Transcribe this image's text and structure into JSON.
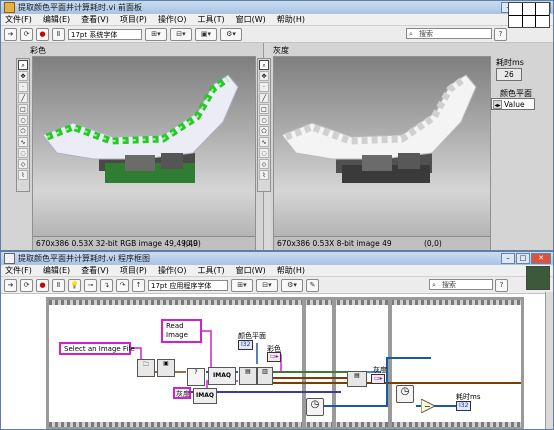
{
  "front_panel": {
    "title": "提取颜色平面并计算耗时.vi 前面板",
    "menu": [
      "文件(F)",
      "编辑(E)",
      "查看(V)",
      "项目(P)",
      "操作(O)",
      "工具(T)",
      "窗口(W)",
      "帮助(H)"
    ],
    "font_selector": "17pt 系统字体",
    "search_placeholder": "搜索",
    "color_display": {
      "label": "彩色",
      "status": "670x386 0.53X 32-bit RGB image 49,49,49",
      "coords": "(0,0)"
    },
    "gray_display": {
      "label": "灰度",
      "status": "670x386 0.53X 8-bit image 49",
      "coords": "(0,0)"
    },
    "elapsed": {
      "label": "耗时ms",
      "value": "26"
    },
    "color_plane": {
      "label": "颜色平面",
      "value": "Value"
    }
  },
  "block_diagram": {
    "title": "提取颜色平面并计算耗时.vi 程序框图",
    "menu": [
      "文件(F)",
      "编辑(E)",
      "查看(V)",
      "项目(P)",
      "操作(O)",
      "工具(T)",
      "窗口(W)",
      "帮助(H)"
    ],
    "font_selector": "17pt 应用程序字体",
    "search_placeholder": "搜索",
    "select_file_const": "Select an Image File",
    "read_image_const_1": "Read",
    "read_image_const_2": "Image",
    "gray_const": "灰度",
    "color_plane_label": "颜色平面",
    "color_plane_term": "I32",
    "color_label": "彩色",
    "gray_label": "灰度",
    "elapsed_label": "耗时ms",
    "elapsed_term": "I32",
    "imaq_1": "IMAQ",
    "imaq_2": "IMAQ"
  }
}
